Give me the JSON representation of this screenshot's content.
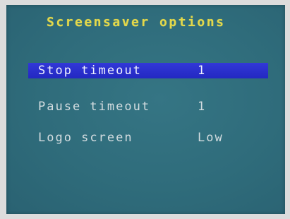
{
  "osd": {
    "title": "Screensaver options",
    "items": [
      {
        "label": "Stop timeout",
        "value": "1",
        "selected": true
      },
      {
        "label": "Pause timeout",
        "value": "1",
        "selected": false
      },
      {
        "label": "Logo screen",
        "value": "Low",
        "selected": false
      }
    ]
  },
  "colors": {
    "background": "#2e6b7a",
    "title": "#e3d84a",
    "highlight": "#2a2fcf",
    "text": "#d4dde0"
  }
}
